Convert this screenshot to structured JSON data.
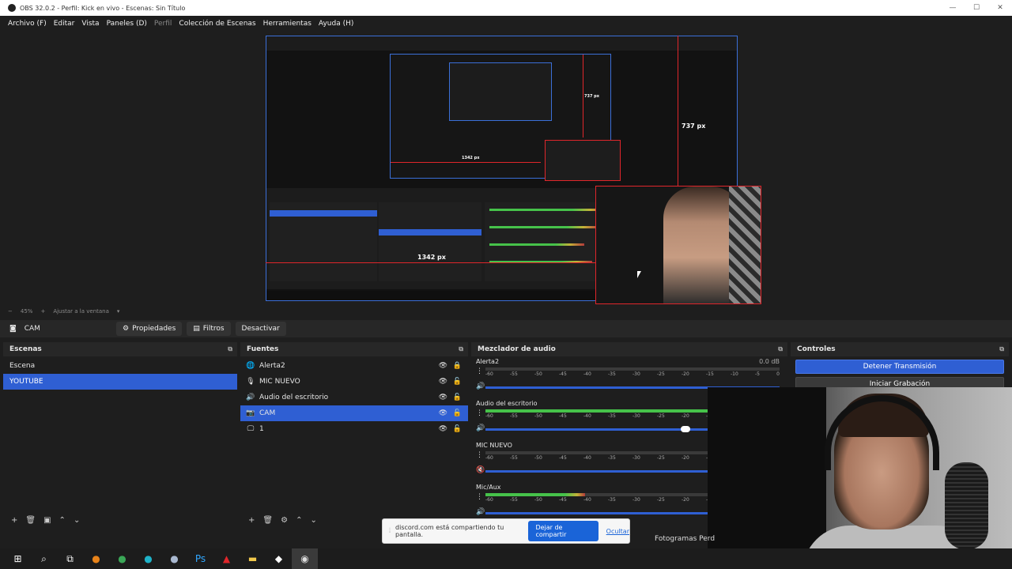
{
  "window": {
    "title": "OBS 32.0.2 - Perfil: Kick en vivo - Escenas: Sin Título",
    "controls": [
      "—",
      "☐",
      "✕"
    ]
  },
  "menu": [
    {
      "label": "Archivo (F)",
      "enabled": true
    },
    {
      "label": "Editar",
      "enabled": true
    },
    {
      "label": "Vista",
      "enabled": true
    },
    {
      "label": "Paneles (D)",
      "enabled": true
    },
    {
      "label": "Perfil",
      "enabled": false
    },
    {
      "label": "Colección de Escenas",
      "enabled": true
    },
    {
      "label": "Herramientas",
      "enabled": true
    },
    {
      "label": "Ayuda (H)",
      "enabled": true
    }
  ],
  "preview": {
    "height_label": "737 px",
    "width_label": "1342 px",
    "nested_label": "737 px",
    "nested_width_label": "1342 px"
  },
  "zoom": {
    "minus": "−",
    "value": "45%",
    "plus": "+",
    "fit_label": "Ajustar a la ventana"
  },
  "source_toolbar": {
    "source_name": "CAM",
    "properties": "Propiedades",
    "filters": "Filtros",
    "deactivate": "Desactivar"
  },
  "scenes": {
    "title": "Escenas",
    "items": [
      {
        "label": "Escena",
        "selected": false
      },
      {
        "label": "YOUTUBE",
        "selected": true
      }
    ]
  },
  "sources": {
    "title": "Fuentes",
    "items": [
      {
        "label": "Alerta2",
        "icon": "globe-icon",
        "glyph": "🌐",
        "selected": false,
        "locked": true
      },
      {
        "label": "MIC NUEVO",
        "icon": "microphone-icon",
        "glyph": "🎙",
        "selected": false,
        "locked": false
      },
      {
        "label": "Audio del escritorio",
        "icon": "speaker-icon",
        "glyph": "🔊",
        "selected": false,
        "locked": false
      },
      {
        "label": "CAM",
        "icon": "camera-icon",
        "glyph": "📷",
        "selected": true,
        "locked": false
      },
      {
        "label": "1",
        "icon": "monitor-icon",
        "glyph": "🖵",
        "selected": false,
        "locked": false
      }
    ]
  },
  "mixer": {
    "title": "Mezclador de audio",
    "ticks": [
      "-60",
      "-55",
      "-50",
      "-45",
      "-40",
      "-35",
      "-30",
      "-25",
      "-20",
      "-15",
      "-10",
      "-5",
      "0"
    ],
    "channels": [
      {
        "name": "Alerta2",
        "db": "0.0 dB",
        "level": 0.0,
        "volume": 1.0,
        "muted": false
      },
      {
        "name": "Audio del escritorio",
        "db": "",
        "level": 0.94,
        "volume": 0.68,
        "muted": false
      },
      {
        "name": "MIC NUEVO",
        "db": "",
        "level": 0.0,
        "volume": 1.0,
        "muted": true
      },
      {
        "name": "Mic/Aux",
        "db": "",
        "level": 0.34,
        "volume": 1.0,
        "muted": false
      }
    ]
  },
  "controls": {
    "title": "Controles",
    "stop_stream": "Detener Transmisión",
    "start_recording": "Iniciar Grabación"
  },
  "share_notice": {
    "text": "discord.com está compartiendo tu pantalla.",
    "stop": "Dejar de compartir",
    "hide": "Ocultar"
  },
  "status": {
    "frames_label": "Fotogramas Perd"
  },
  "taskbar": {
    "items": [
      {
        "name": "start-icon",
        "glyph": "⊞",
        "color": "#ffffff"
      },
      {
        "name": "search-icon",
        "glyph": "⌕",
        "color": "#ffffff"
      },
      {
        "name": "task-view-icon",
        "glyph": "⧉",
        "color": "#ffffff"
      },
      {
        "name": "firefox-icon",
        "glyph": "●",
        "color": "#e8831a"
      },
      {
        "name": "chrome-icon",
        "glyph": "●",
        "color": "#3aa757"
      },
      {
        "name": "edge-icon",
        "glyph": "●",
        "color": "#1fb3c9"
      },
      {
        "name": "steam-icon",
        "glyph": "●",
        "color": "#a9b8d0"
      },
      {
        "name": "photoshop-icon",
        "glyph": "Ps",
        "color": "#31a8ff"
      },
      {
        "name": "davinci-icon",
        "glyph": "▲",
        "color": "#e0262b"
      },
      {
        "name": "file-explorer-icon",
        "glyph": "▬",
        "color": "#f2c94c"
      },
      {
        "name": "app-icon",
        "glyph": "◆",
        "color": "#ffffff"
      },
      {
        "name": "obs-icon",
        "glyph": "◉",
        "color": "#dddddd",
        "active": true
      }
    ]
  }
}
